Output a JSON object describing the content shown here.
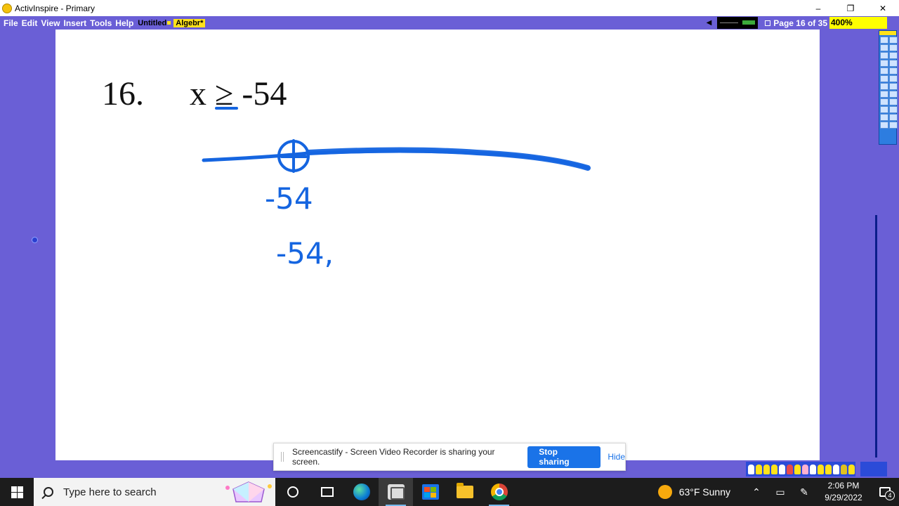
{
  "window": {
    "title": "ActivInspire - Primary",
    "controls": {
      "minimize": "–",
      "restore": "❐",
      "close": "✕"
    }
  },
  "menu": {
    "items": [
      "File",
      "Edit",
      "View",
      "Insert",
      "Tools",
      "Help"
    ],
    "doc_tabs": [
      "Untitled",
      "Algebr*"
    ],
    "page_indicator": "Page 16 of 35",
    "zoom": "400%"
  },
  "flipchart": {
    "problem_number": "16.",
    "inequality": "x ≥ -54",
    "ink_label_1": "-54",
    "ink_label_2": "-54,",
    "ink_color": "#1565e0"
  },
  "sharebar": {
    "message": "Screencastify - Screen Video Recorder is sharing your screen.",
    "stop_label": "Stop sharing",
    "hide_label": "Hide"
  },
  "taskbar": {
    "search_placeholder": "Type here to search",
    "weather": "63°F  Sunny",
    "time": "2:06 PM",
    "date": "9/29/2022",
    "notification_count": "4"
  },
  "colors": {
    "background": "#6a5fd6",
    "accent": "#1a73e8",
    "highlight": "#ffff00"
  }
}
